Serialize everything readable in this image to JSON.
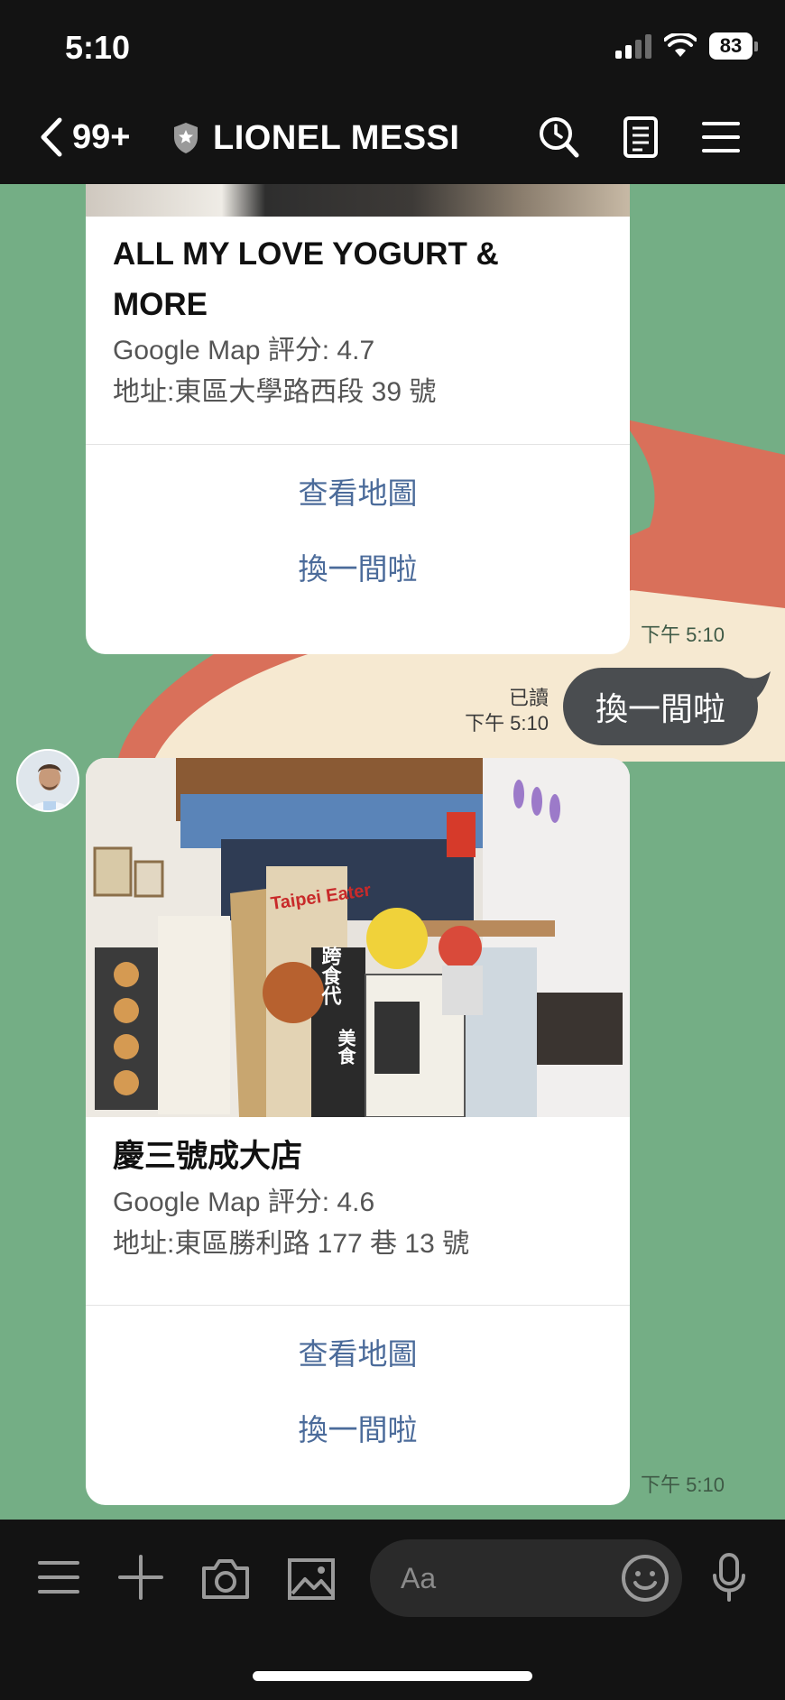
{
  "status_bar": {
    "time": "5:10",
    "battery": "83"
  },
  "header": {
    "unread_count": "99+",
    "chat_name": "LIONEL MESSI"
  },
  "messages": [
    {
      "type": "card",
      "title_line1": "ALL MY LOVE YOGURT &",
      "title_line2": "MORE",
      "rating": "Google Map 評分: 4.7",
      "address": "地址:東區大學路西段 39 號",
      "button_map": "查看地圖",
      "button_switch": "換一間啦",
      "time": "下午 5:10"
    },
    {
      "type": "user",
      "text": "換一間啦",
      "read": "已讀",
      "time": "下午 5:10"
    },
    {
      "type": "card",
      "title": "慶三號成大店",
      "rating": "Google Map 評分: 4.6",
      "address": "地址:東區勝利路 177 巷 13 號",
      "button_map": "查看地圖",
      "button_switch": "換一間啦",
      "time": "下午 5:10"
    }
  ],
  "photo_texts": {
    "sign": "Taipei Eater",
    "banner1": "跨食代",
    "banner2": "美食"
  },
  "input": {
    "placeholder": "Aa"
  },
  "colors": {
    "chat_bg": "#74ae85",
    "bar_bg": "#131313",
    "link": "#4b6b9a",
    "bubble": "#4a4d50"
  }
}
